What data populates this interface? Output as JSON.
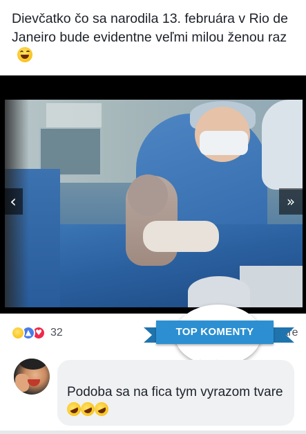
{
  "post": {
    "caption": "Dievčatko čo sa narodila 13. februára v Rio de Janeiro bude evidentne veľmi milou ženou raz",
    "caption_emoji": "laughing-emoji"
  },
  "viewer": {
    "prev_label": "‹",
    "next_label": "»"
  },
  "reactions": {
    "icons": [
      "haha-icon",
      "like-icon",
      "love-icon"
    ],
    "count": "32",
    "comments_partial": "ntáre"
  },
  "sticker": {
    "label": "TOP KOMENTY",
    "color": "#2c8fd1"
  },
  "comment": {
    "text": "Podoba sa na fica tym vyrazom tvare",
    "emojis": [
      "rofl-emoji",
      "rofl-emoji",
      "rofl-emoji"
    ]
  },
  "colors": {
    "background": "#ffffff",
    "comment_bg": "#eff1f3",
    "like": "#4a7ce8",
    "love": "#f0284a"
  }
}
